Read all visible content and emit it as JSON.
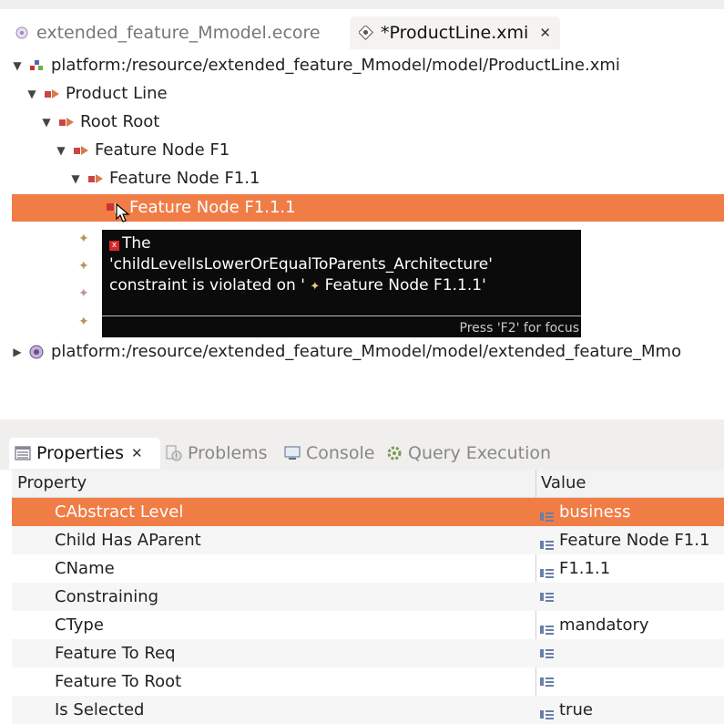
{
  "editor_tabs": [
    {
      "label": "extended_feature_Mmodel.ecore",
      "icon": "ecore-file-icon",
      "active": false
    },
    {
      "label": "*ProductLine.xmi",
      "icon": "xmi-file-icon",
      "active": true,
      "close": "✕"
    }
  ],
  "tree": {
    "resource1": "platform:/resource/extended_feature_Mmodel/model/ProductLine.xmi",
    "product_line": "Product Line",
    "root": "Root Root",
    "f1": "Feature Node F1",
    "f11": "Feature Node F1.1",
    "f111": "Feature Node F1.1.1",
    "resource2": "platform:/resource/extended_feature_Mmodel/model/extended_feature_Mmo"
  },
  "tooltip": {
    "line1": "The",
    "line2": "'childLevelIsLowerOrEqualToParents_Architecture'",
    "line3_prefix": "constraint is violated on '",
    "line3_value": "Feature Node F1.1.1'",
    "hint": "Press 'F2' for focus"
  },
  "view_tabs": [
    {
      "label": "Properties",
      "icon": "properties-icon",
      "active": true,
      "close": "✕"
    },
    {
      "label": "Problems",
      "icon": "problems-icon",
      "active": false
    },
    {
      "label": "Console",
      "icon": "console-icon",
      "active": false
    },
    {
      "label": "Query Execution",
      "icon": "query-icon",
      "active": false
    }
  ],
  "properties": {
    "header": {
      "property": "Property",
      "value": "Value"
    },
    "rows": [
      {
        "name": "CAbstract Level",
        "value": "business"
      },
      {
        "name": "Child Has AParent",
        "value": "Feature Node F1.1"
      },
      {
        "name": "CName",
        "value": "F1.1.1"
      },
      {
        "name": "Constraining",
        "value": ""
      },
      {
        "name": "CType",
        "value": "mandatory"
      },
      {
        "name": "Feature To Req",
        "value": ""
      },
      {
        "name": "Feature To Root",
        "value": ""
      },
      {
        "name": "Is Selected",
        "value": "true"
      }
    ]
  },
  "colors": {
    "selection": "#f07d46",
    "tooltip_bg": "#0b0b0b",
    "error": "#d9252b"
  }
}
